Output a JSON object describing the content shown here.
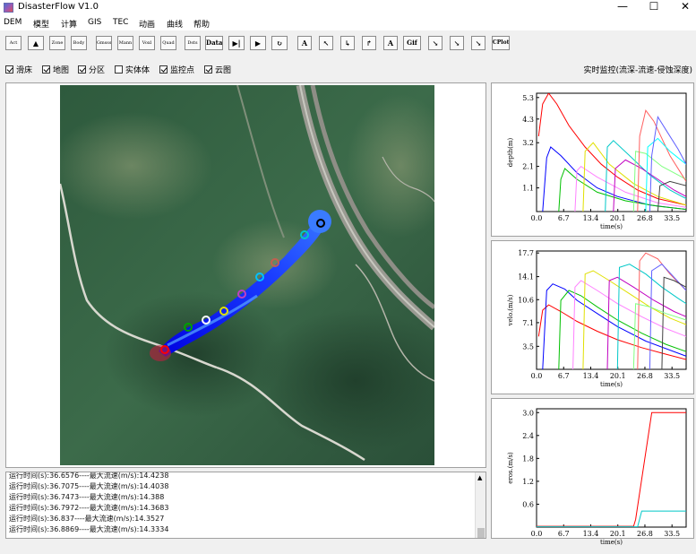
{
  "window": {
    "title": "DisasterFlow V1.0",
    "min_label": "—",
    "max_label": "☐",
    "close_label": "✕"
  },
  "menu": [
    "DEM",
    "模型",
    "计算",
    "GIS",
    "TEC",
    "动画",
    "曲线",
    "帮助"
  ],
  "toolbar": {
    "buttons": [
      "Act",
      "▲",
      "Zone",
      "Body",
      "Gmsss",
      "Mann",
      "Voxl",
      "Quad",
      "Dsts",
      "Data",
      "▶|",
      "▶",
      "↻",
      "A",
      "↖",
      "↳",
      "↱",
      "A",
      "Gif",
      "↘",
      "↘",
      "↘",
      "CPlot"
    ]
  },
  "layers": [
    {
      "label": "滑床",
      "checked": true
    },
    {
      "label": "地图",
      "checked": true
    },
    {
      "label": "分区",
      "checked": true
    },
    {
      "label": "实体体",
      "checked": false
    },
    {
      "label": "监控点",
      "checked": true
    },
    {
      "label": "云图",
      "checked": true
    }
  ],
  "monitor_label": "实时监控(流深-流速-侵蚀深度)",
  "log": {
    "lines": [
      "运行时间(s):36.6576----最大流速(m/s):14.4238",
      "运行时间(s):36.7075----最大流速(m/s):14.4038",
      "运行时间(s):36.7473----最大流速(m/s):14.388",
      "运行时间(s):36.7972----最大流速(m/s):14.3683",
      "运行时间(s):36.837----最大流速(m/s):14.3527",
      "运行时间(s):36.8869----最大流速(m/s):14.3334"
    ],
    "scroll_up_label": "▲"
  },
  "colors": {
    "flow_blue": "#0a2cff",
    "monitor_points": [
      "#000000",
      "#00c8c8",
      "#c8c800",
      "#ff4040",
      "#00c0ff",
      "#c040c0",
      "#e0e000",
      "#ffffff",
      "#00a000",
      "#ff0000"
    ]
  },
  "chart_data": [
    {
      "type": "line",
      "xlabel": "time(s)",
      "ylabel": "depth(m)",
      "xticks": [
        "0.0",
        "6.7",
        "13.4",
        "20.1",
        "26.8",
        "33.5"
      ],
      "yticks": [
        "1.1",
        "2.1",
        "3.2",
        "4.3",
        "5.3"
      ],
      "xlim": [
        0,
        37
      ],
      "ylim": [
        0,
        5.5
      ],
      "series": [
        {
          "color": "#ff0000",
          "x": [
            0.5,
            1.5,
            3,
            5,
            8,
            12,
            16,
            20,
            25,
            30,
            37
          ],
          "y": [
            3.5,
            5.0,
            5.5,
            5.0,
            4.0,
            3.0,
            2.2,
            1.6,
            1.0,
            0.6,
            0.3
          ]
        },
        {
          "color": "#0000ff",
          "x": [
            1.5,
            2.5,
            3.5,
            6,
            10,
            15,
            20,
            28,
            37
          ],
          "y": [
            0,
            2.5,
            3.0,
            2.6,
            1.8,
            1.1,
            0.7,
            0.3,
            0.1
          ]
        },
        {
          "color": "#00c000",
          "x": [
            5.5,
            6,
            7,
            10,
            15,
            22,
            30,
            37
          ],
          "y": [
            0,
            1.5,
            2.0,
            1.5,
            0.9,
            0.5,
            0.25,
            0.1
          ]
        },
        {
          "color": "#ff80ff",
          "x": [
            9.5,
            10,
            11,
            15,
            22,
            30,
            37
          ],
          "y": [
            0,
            1.9,
            2.1,
            1.6,
            0.9,
            0.4,
            0.2
          ]
        },
        {
          "color": "#e0e000",
          "x": [
            11.5,
            12,
            14,
            18,
            24,
            30,
            37
          ],
          "y": [
            0,
            2.8,
            3.2,
            2.2,
            1.3,
            0.7,
            0.3
          ]
        },
        {
          "color": "#00c8c8",
          "x": [
            17,
            17.5,
            19,
            23,
            28,
            33,
            37
          ],
          "y": [
            0,
            3.0,
            3.3,
            2.6,
            1.7,
            1.0,
            0.6
          ]
        },
        {
          "color": "#c000c0",
          "x": [
            19,
            19.5,
            22,
            26,
            30,
            34,
            37
          ],
          "y": [
            0,
            2.0,
            2.4,
            2.0,
            1.5,
            1.0,
            0.7
          ]
        },
        {
          "color": "#80ff80",
          "x": [
            24,
            24.5,
            27,
            31,
            37
          ],
          "y": [
            0,
            2.8,
            2.7,
            2.1,
            1.5
          ]
        },
        {
          "color": "#ff6060",
          "x": [
            25,
            25.5,
            27,
            29,
            33,
            37
          ],
          "y": [
            0,
            3.5,
            4.7,
            4.2,
            2.6,
            1.4
          ]
        },
        {
          "color": "#00ffff",
          "x": [
            27,
            27.5,
            30,
            33,
            37
          ],
          "y": [
            0,
            3.0,
            3.4,
            2.8,
            2.2
          ]
        },
        {
          "color": "#6060ff",
          "x": [
            28,
            28.5,
            30,
            32,
            35,
            37
          ],
          "y": [
            0,
            2.6,
            4.4,
            3.8,
            2.9,
            2.2
          ]
        },
        {
          "color": "#404040",
          "x": [
            30,
            30.5,
            33,
            37
          ],
          "y": [
            0,
            1.2,
            1.4,
            1.2
          ]
        }
      ]
    },
    {
      "type": "line",
      "xlabel": "time(s)",
      "ylabel": "velo.(m/s)",
      "xticks": [
        "0.0",
        "6.7",
        "13.4",
        "20.1",
        "26.8",
        "33.5"
      ],
      "yticks": [
        "3.5",
        "7.1",
        "10.6",
        "14.1",
        "17.7"
      ],
      "xlim": [
        0,
        37
      ],
      "ylim": [
        0,
        18
      ],
      "series": [
        {
          "color": "#ff0000",
          "x": [
            0.5,
            1.5,
            3,
            6,
            10,
            15,
            20,
            26,
            32,
            37
          ],
          "y": [
            5,
            9,
            9.8,
            8.8,
            7.3,
            5.8,
            4.5,
            3.3,
            2.3,
            1.5
          ]
        },
        {
          "color": "#0000ff",
          "x": [
            1.5,
            2.5,
            4,
            7,
            10,
            15,
            20,
            27,
            37
          ],
          "y": [
            0,
            12,
            13.0,
            12.2,
            10.5,
            8.5,
            6.5,
            4.3,
            2.0
          ]
        },
        {
          "color": "#00c000",
          "x": [
            5.5,
            6,
            8,
            11,
            15,
            20,
            26,
            32,
            37
          ],
          "y": [
            0,
            10.5,
            12.0,
            11.2,
            9.5,
            7.5,
            5.5,
            3.8,
            2.7
          ]
        },
        {
          "color": "#ff80ff",
          "x": [
            9,
            9.5,
            11,
            15,
            20,
            26,
            32,
            37
          ],
          "y": [
            0,
            12.5,
            13.5,
            12.0,
            10.0,
            8.0,
            6.2,
            5.0
          ]
        },
        {
          "color": "#e0e000",
          "x": [
            11.5,
            12,
            14,
            18,
            23,
            28,
            33,
            37
          ],
          "y": [
            0,
            14.5,
            15.0,
            13.5,
            11.5,
            9.5,
            7.8,
            6.8
          ]
        },
        {
          "color": "#c000c0",
          "x": [
            17.5,
            18,
            20,
            24,
            29,
            34,
            37
          ],
          "y": [
            0,
            13.5,
            14.0,
            12.5,
            10.5,
            8.8,
            8.0
          ]
        },
        {
          "color": "#00c8c8",
          "x": [
            20,
            20.5,
            23,
            27,
            31,
            35,
            37
          ],
          "y": [
            0,
            15.5,
            16.0,
            14.5,
            12.5,
            10.8,
            10.0
          ]
        },
        {
          "color": "#ff6060",
          "x": [
            25,
            25.5,
            27,
            30,
            33,
            37
          ],
          "y": [
            0,
            16.5,
            17.7,
            16.8,
            14.5,
            12.0
          ]
        },
        {
          "color": "#6060ff",
          "x": [
            28,
            28.5,
            31,
            34,
            37
          ],
          "y": [
            0,
            15.0,
            16.0,
            14.0,
            12.0
          ]
        },
        {
          "color": "#404040",
          "x": [
            31,
            31.5,
            34,
            37
          ],
          "y": [
            0,
            14.0,
            13.5,
            12.5
          ]
        },
        {
          "color": "#80ff80",
          "x": [
            24,
            24.5,
            28,
            32,
            37
          ],
          "y": [
            0,
            10.0,
            9.5,
            8.5,
            7.5
          ]
        }
      ]
    },
    {
      "type": "line",
      "xlabel": "time(s)",
      "ylabel": "eros.(m/s)",
      "xticks": [
        "0.0",
        "6.7",
        "13.4",
        "20.1",
        "26.8",
        "33.5"
      ],
      "yticks": [
        "0.6",
        "1.2",
        "1.8",
        "2.4",
        "3.0"
      ],
      "xlim": [
        0,
        37
      ],
      "ylim": [
        0,
        3.1
      ],
      "series": [
        {
          "color": "#ff0000",
          "x": [
            0,
            24,
            24.5,
            28.5,
            37
          ],
          "y": [
            0.02,
            0.02,
            0.2,
            3.0,
            3.0
          ]
        },
        {
          "color": "#00c8c8",
          "x": [
            0,
            25,
            26,
            37
          ],
          "y": [
            0.01,
            0.01,
            0.42,
            0.42
          ]
        }
      ]
    }
  ]
}
